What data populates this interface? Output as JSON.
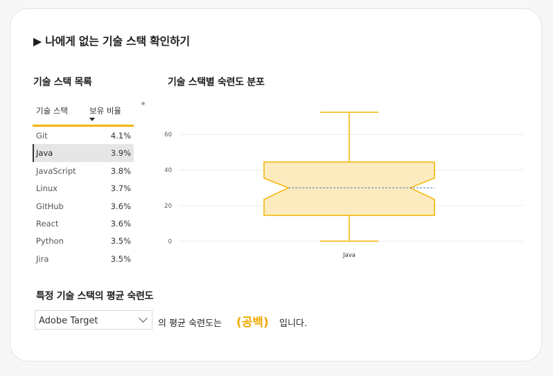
{
  "page": {
    "title": "▶ 나에게 없는 기술 스택 확인하기"
  },
  "skill_list": {
    "title": "기술 스택 목록",
    "columns": [
      "기술 스택",
      "보유 비율"
    ],
    "sort_column": "보유 비율",
    "rows": [
      {
        "name": "Git",
        "pct": "4.1%"
      },
      {
        "name": "Java",
        "pct": "3.9%",
        "selected": true
      },
      {
        "name": "JavaScript",
        "pct": "3.8%"
      },
      {
        "name": "Linux",
        "pct": "3.7%"
      },
      {
        "name": "GitHub",
        "pct": "3.6%"
      },
      {
        "name": "React",
        "pct": "3.6%"
      },
      {
        "name": "Python",
        "pct": "3.5%"
      },
      {
        "name": "Jira",
        "pct": "3.5%"
      }
    ]
  },
  "chart_title": "기술 스택별 숙련도 분포",
  "chart_data": {
    "type": "box",
    "categories": [
      "Java"
    ],
    "boxes": [
      {
        "category": "Java",
        "min": 0,
        "q1": 14.5,
        "median": 30,
        "q3": 44.5,
        "max": 72.5,
        "mean": 30,
        "notch_low": 23.5,
        "notch_high": 35.5
      }
    ],
    "y_ticks": [
      0,
      20,
      40,
      60
    ],
    "ylim": [
      -3,
      78
    ],
    "grid": true,
    "colors": {
      "fill": "#fdebc0",
      "stroke": "#f2b400",
      "mean_line": "#4a7fb5",
      "grid": "#ececec"
    }
  },
  "average": {
    "title": "특정 기술 스택의 평균 숙련도",
    "selected_skill": "Adobe Target",
    "sentence_prefix": "의 평균 숙련도는",
    "value": "(공백)",
    "sentence_suffix": "입니다."
  },
  "colors": {
    "accent": "#f2b400",
    "value_text": "#f2a900"
  }
}
